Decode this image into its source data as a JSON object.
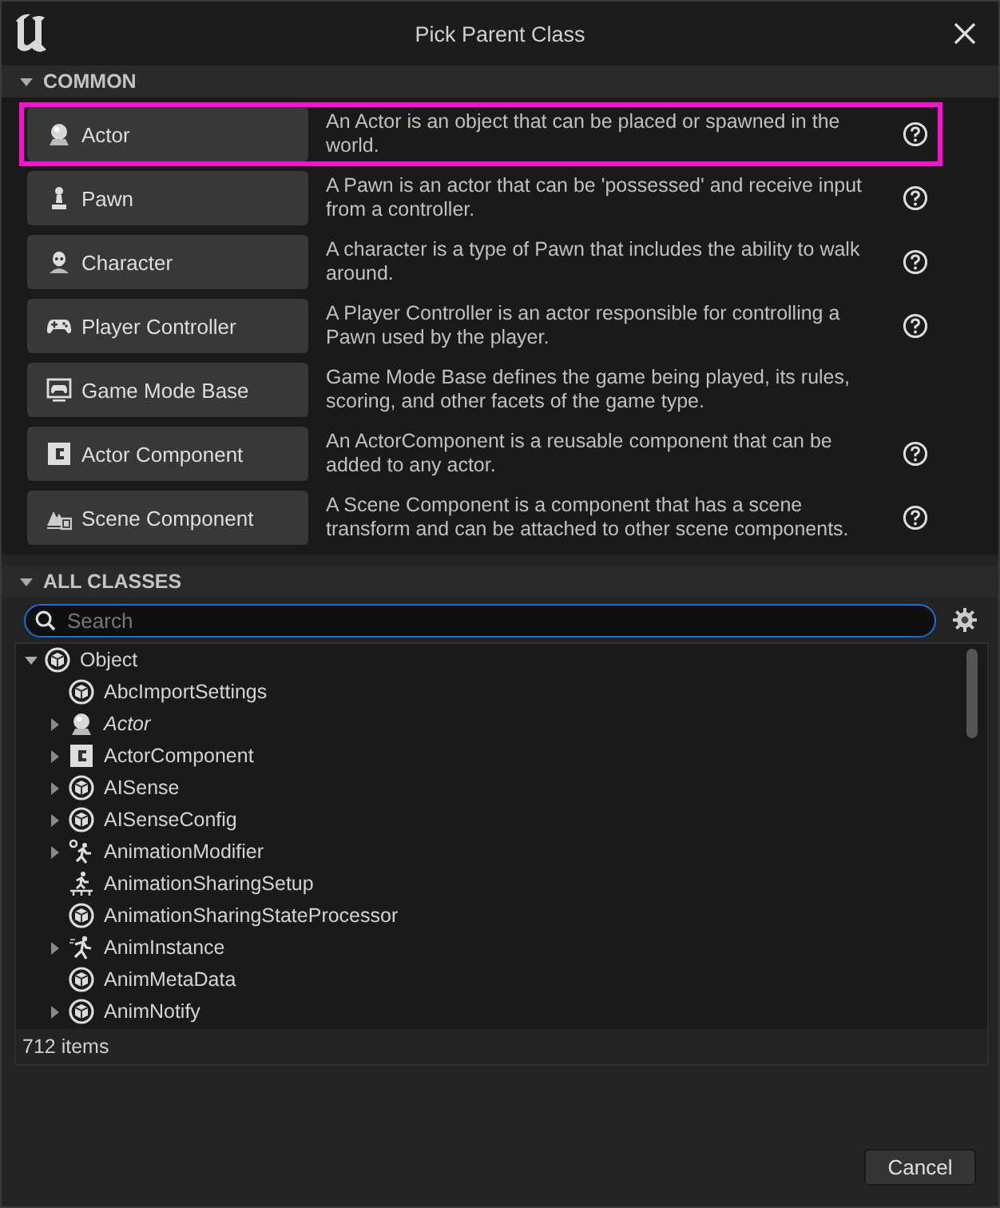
{
  "window": {
    "title": "Pick Parent Class"
  },
  "common": {
    "header": "COMMON",
    "expanded": true,
    "items": [
      {
        "label": "Actor",
        "kind": "actor",
        "description": "An Actor is an object that can be placed or spawned in the world.",
        "help": true,
        "selected": true
      },
      {
        "label": "Pawn",
        "kind": "pawn",
        "description": "A Pawn is an actor that can be 'possessed' and receive input from a controller.",
        "help": true,
        "selected": false
      },
      {
        "label": "Character",
        "kind": "character",
        "description": "A character is a type of Pawn that includes the ability to walk around.",
        "help": true,
        "selected": false
      },
      {
        "label": "Player Controller",
        "kind": "controller",
        "description": "A Player Controller is an actor responsible for controlling a Pawn used by the player.",
        "help": true,
        "selected": false
      },
      {
        "label": "Game Mode Base",
        "kind": "gamemode",
        "description": "Game Mode Base defines the game being played, its rules, scoring, and other facets of the game type.",
        "help": false,
        "selected": false
      },
      {
        "label": "Actor Component",
        "kind": "component",
        "description": "An ActorComponent is a reusable component that can be added to any actor.",
        "help": true,
        "selected": false
      },
      {
        "label": "Scene Component",
        "kind": "scene",
        "description": "A Scene Component is a component that has a scene transform and can be attached to other scene components.",
        "help": true,
        "selected": false
      }
    ]
  },
  "all_classes": {
    "header": "ALL CLASSES",
    "expanded": true,
    "search": {
      "placeholder": "Search"
    },
    "tree": [
      {
        "label": "Object",
        "kind": "object",
        "expandable": true,
        "expanded": true,
        "italic": false,
        "children": [
          {
            "label": "AbcImportSettings",
            "kind": "object",
            "expandable": false,
            "italic": false
          },
          {
            "label": "Actor",
            "kind": "actor",
            "expandable": true,
            "expanded": false,
            "italic": true
          },
          {
            "label": "ActorComponent",
            "kind": "component",
            "expandable": true,
            "expanded": false,
            "italic": false
          },
          {
            "label": "AISense",
            "kind": "object",
            "expandable": true,
            "expanded": false,
            "italic": false
          },
          {
            "label": "AISenseConfig",
            "kind": "object",
            "expandable": true,
            "expanded": false,
            "italic": false
          },
          {
            "label": "AnimationModifier",
            "kind": "anim-gear",
            "expandable": true,
            "expanded": false,
            "italic": false
          },
          {
            "label": "AnimationSharingSetup",
            "kind": "anim-platform",
            "expandable": false,
            "italic": false
          },
          {
            "label": "AnimationSharingStateProcessor",
            "kind": "object",
            "expandable": false,
            "italic": false
          },
          {
            "label": "AnimInstance",
            "kind": "anim",
            "expandable": true,
            "expanded": false,
            "italic": false
          },
          {
            "label": "AnimMetaData",
            "kind": "object",
            "expandable": false,
            "italic": false
          },
          {
            "label": "AnimNotify",
            "kind": "object",
            "expandable": true,
            "expanded": false,
            "italic": false
          }
        ]
      }
    ],
    "item_count": "712 items"
  },
  "buttons": [
    {
      "label": "Cancel"
    }
  ]
}
